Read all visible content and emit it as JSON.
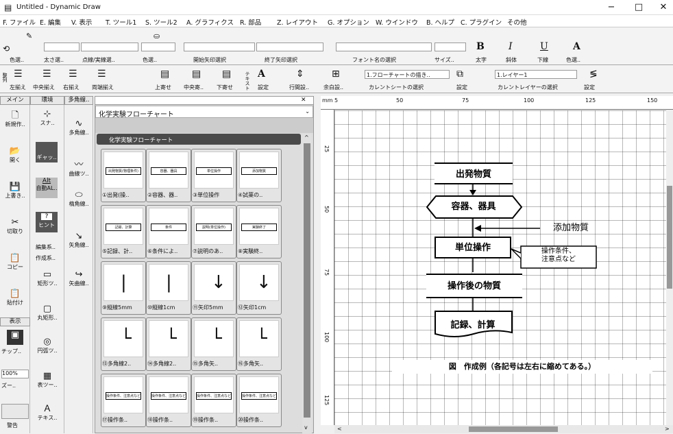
{
  "window": {
    "title": "Untitled - Dynamic Draw",
    "minimize": "−",
    "maximize": "□",
    "close": "✕"
  },
  "menu": [
    "F. ファイル",
    "E. 編集",
    "V. 表示",
    "T. ツール1",
    "S. ツール2",
    "A. グラフィクス",
    "R. 部品",
    "Z. レイアウト",
    "G. オプション",
    "W. ウインドウ",
    "B. ヘルプ",
    "C. プラグイン",
    "その他"
  ],
  "toolbar1": {
    "color": "色選..",
    "line_width": "太さ選..",
    "line_style": "点線/実線選..",
    "fill_color": "色選..",
    "start_arrow": "開始矢印選択",
    "end_arrow": "終了矢印選択",
    "font_label": "フォン..",
    "font_select": "フォント名の選択",
    "size": "サイズ..",
    "bold_glyph": "B",
    "bold": "太字",
    "italic_glyph": "I",
    "italic": "斜体",
    "underline_glyph": "U",
    "underline": "下線",
    "text_color_glyph": "A",
    "text_color": "色選.."
  },
  "toolbar2": {
    "left_label": "左揃え",
    "center_label": "中央揃え",
    "right_label": "右揃え",
    "both_label": "両端揃え",
    "top_label": "上寄せ",
    "middle_label": "中央寄..",
    "bottom_label": "下寄せ",
    "text_label": "テキスト",
    "set1": "設定",
    "spacing": "行間設..",
    "margin": "余白設..",
    "sheet_value": "1.フローチャートの描き..",
    "sheet_select": "カレントシートの選択",
    "set2": "設定",
    "layer_value": "1.レイヤー1",
    "layer_select": "カレントレイヤーの選択",
    "set3": "設定",
    "arrange": "整列",
    "arrange2": "整列"
  },
  "panels": {
    "main": "メイン",
    "env": "環境",
    "poly": "多角線..",
    "library_title": "化学実験フローチャート",
    "library_category": "化学実験フローチャート"
  },
  "sidebar": [
    {
      "icon": "🗋",
      "label": "新規作.."
    },
    {
      "icon": "📂",
      "label": "開く"
    },
    {
      "icon": "💾",
      "label": "上書き.."
    },
    {
      "icon": "✂",
      "label": "切取り"
    },
    {
      "icon": "📋",
      "label": "コピー"
    },
    {
      "icon": "📋",
      "label": "貼付け"
    }
  ],
  "env_tools": [
    "スナ..",
    "ギャッ..",
    "自動AL..",
    "ヒント",
    "編集系..",
    "作成系..",
    "矩形ツ..",
    "丸矩形..",
    "円弧ツ..",
    "表ツー..",
    "テキス.."
  ],
  "env_labels": {
    "alt": "Alt",
    "hint": "?"
  },
  "draw_tools": [
    "多角線..",
    "曲線ツ..",
    "楕角線..",
    "矢角線..",
    "矢曲線.."
  ],
  "view": {
    "tab": "表示",
    "chip": "チップ..",
    "zoom": "100%",
    "zoom_label": "ズー..",
    "warn": "警告"
  },
  "tiles": [
    {
      "caption": "①出発(操..",
      "pic": "出発物質(物理条件)"
    },
    {
      "caption": "②容器、器..",
      "pic": "容器、器具"
    },
    {
      "caption": "③単位操作",
      "pic": "単位操作"
    },
    {
      "caption": "④試薬の..",
      "pic": "添加物質"
    },
    {
      "caption": "⑤記録、計..",
      "pic": "記録、計算"
    },
    {
      "caption": "⑥条件によ..",
      "pic": "条件"
    },
    {
      "caption": "⑦説明のあ..",
      "pic": "説明(単位操作)"
    },
    {
      "caption": "⑧実験終..",
      "pic": "実験終了"
    },
    {
      "caption": "⑨縦線5mm",
      "pic": ""
    },
    {
      "caption": "⑩縦線1cm",
      "pic": ""
    },
    {
      "caption": "⑪矢印5mm",
      "pic": ""
    },
    {
      "caption": "⑫矢印1cm",
      "pic": ""
    },
    {
      "caption": "⑬多角線2..",
      "pic": ""
    },
    {
      "caption": "⑭多角線2..",
      "pic": ""
    },
    {
      "caption": "⑮多角矢..",
      "pic": ""
    },
    {
      "caption": "⑯多角矢..",
      "pic": ""
    },
    {
      "caption": "⑰操作条..",
      "pic": "操作条件、注意点など"
    },
    {
      "caption": "⑱操作条..",
      "pic": "操作条件、注意点など"
    },
    {
      "caption": "⑲操作条..",
      "pic": "操作条件、注意点など"
    },
    {
      "caption": "⑳操作条..",
      "pic": "操作条件、注意点など"
    }
  ],
  "ruler": {
    "unit": "mm",
    "marks": [
      "5",
      "50",
      "75",
      "100",
      "125",
      "150"
    ],
    "vmarks": [
      "25",
      "50",
      "75",
      "100",
      "125"
    ]
  },
  "flow": {
    "start": "出発物質",
    "vessel": "容器、器具",
    "additive": "添加物質",
    "unit_op": "単位操作",
    "condition": "操作条件、\n注意点など",
    "after": "操作後の物質",
    "record": "記録、計算",
    "caption": "図　作成例（各記号は左右に縮めてある。）"
  },
  "scroll": {
    "left": "<",
    "right": ">",
    "up": "^",
    "down": "v"
  }
}
